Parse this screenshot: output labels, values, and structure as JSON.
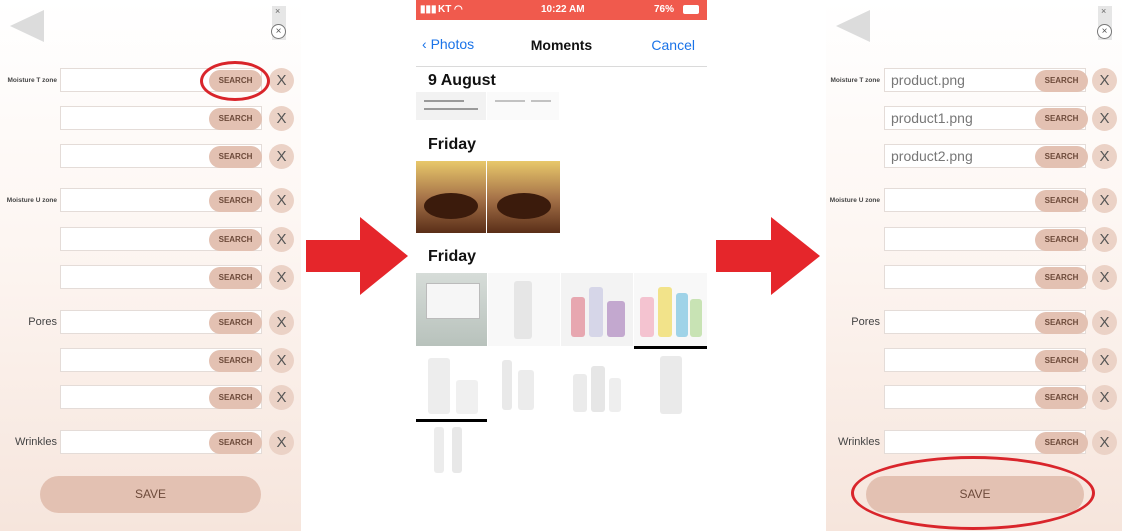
{
  "left_screen": {
    "rows": [
      {
        "label": "Moisture T zone",
        "value": "",
        "search_label": "SEARCH",
        "clear_label": "X"
      },
      {
        "label": "",
        "value": "",
        "search_label": "SEARCH",
        "clear_label": "X"
      },
      {
        "label": "",
        "value": "",
        "search_label": "SEARCH",
        "clear_label": "X"
      },
      {
        "label": "Moisture U zone",
        "value": "",
        "search_label": "SEARCH",
        "clear_label": "X"
      },
      {
        "label": "",
        "value": "",
        "search_label": "SEARCH",
        "clear_label": "X"
      },
      {
        "label": "",
        "value": "",
        "search_label": "SEARCH",
        "clear_label": "X"
      },
      {
        "label": "Pores",
        "value": "",
        "search_label": "SEARCH",
        "clear_label": "X"
      },
      {
        "label": "",
        "value": "",
        "search_label": "SEARCH",
        "clear_label": "X"
      },
      {
        "label": "",
        "value": "",
        "search_label": "SEARCH",
        "clear_label": "X"
      },
      {
        "label": "Wrinkles",
        "value": "",
        "search_label": "SEARCH",
        "clear_label": "X"
      }
    ],
    "save_label": "SAVE"
  },
  "photo_picker": {
    "status": {
      "carrier": "KT",
      "time": "10:22 AM",
      "battery": "76%"
    },
    "nav": {
      "back_label": "Photos",
      "title": "Moments",
      "cancel_label": "Cancel"
    },
    "sections": [
      "9 August",
      "Friday",
      "Friday"
    ]
  },
  "right_screen": {
    "rows": [
      {
        "label": "Moisture T zone",
        "value": "product.png",
        "search_label": "SEARCH",
        "clear_label": "X"
      },
      {
        "label": "",
        "value": "product1.png",
        "search_label": "SEARCH",
        "clear_label": "X"
      },
      {
        "label": "",
        "value": "product2.png",
        "search_label": "SEARCH",
        "clear_label": "X"
      },
      {
        "label": "Moisture U zone",
        "value": "",
        "search_label": "SEARCH",
        "clear_label": "X"
      },
      {
        "label": "",
        "value": "",
        "search_label": "SEARCH",
        "clear_label": "X"
      },
      {
        "label": "",
        "value": "",
        "search_label": "SEARCH",
        "clear_label": "X"
      },
      {
        "label": "Pores",
        "value": "",
        "search_label": "SEARCH",
        "clear_label": "X"
      },
      {
        "label": "",
        "value": "",
        "search_label": "SEARCH",
        "clear_label": "X"
      },
      {
        "label": "",
        "value": "",
        "search_label": "SEARCH",
        "clear_label": "X"
      },
      {
        "label": "Wrinkles",
        "value": "",
        "search_label": "SEARCH",
        "clear_label": "X"
      }
    ],
    "save_label": "SAVE"
  },
  "colors": {
    "accent_button": "#e3c1b2",
    "highlight_red": "#d9252b",
    "ios_blue": "#1a73e8",
    "status_bar": "#f05a4d"
  }
}
